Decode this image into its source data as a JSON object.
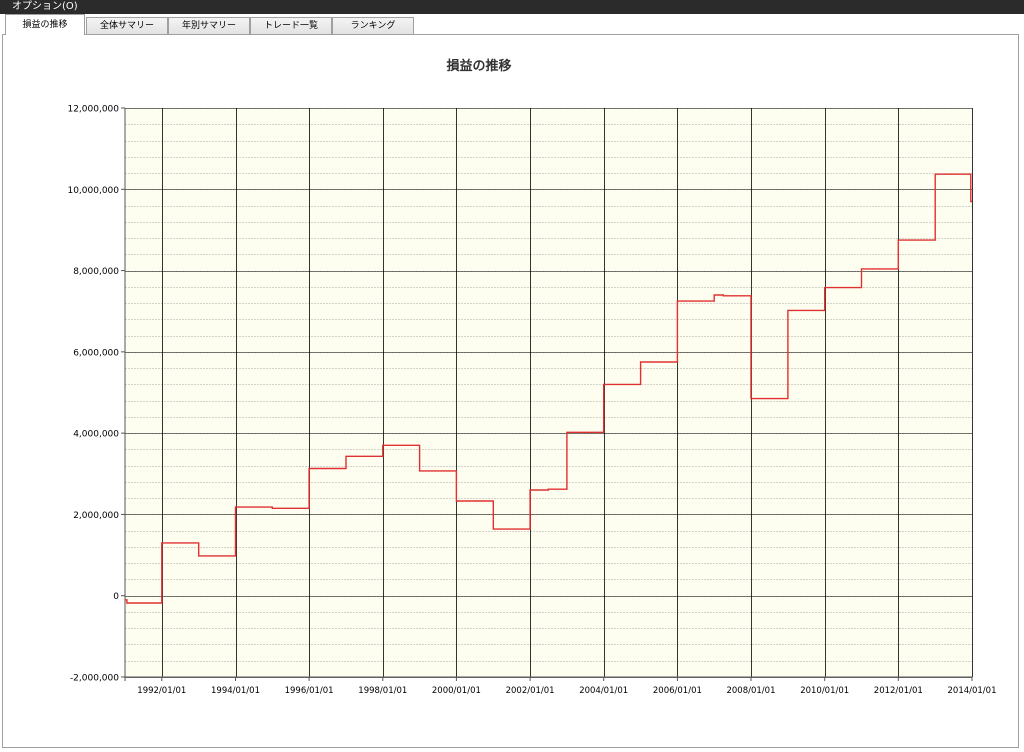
{
  "menubar": {
    "options_label": "オプション(O)"
  },
  "tabs": [
    {
      "label": "損益の推移",
      "active": true
    },
    {
      "label": "全体サマリー",
      "active": false
    },
    {
      "label": "年別サマリー",
      "active": false
    },
    {
      "label": "トレード一覧",
      "active": false
    },
    {
      "label": "ランキング",
      "active": false
    }
  ],
  "colors": {
    "plot_background": "#fefef0",
    "line": "#e03030",
    "major_grid": "#000000",
    "minor_grid": "#a8a8a8"
  },
  "chart_data": {
    "type": "line",
    "title": "損益の推移",
    "xlabel": "",
    "ylabel": "",
    "x_range": [
      "1991/01/01",
      "2014/01/01"
    ],
    "ylim": [
      -2000000,
      12000000
    ],
    "y_ticks": [
      -2000000,
      0,
      2000000,
      4000000,
      6000000,
      8000000,
      10000000,
      12000000
    ],
    "y_tick_labels": [
      "-2,000,000",
      "0",
      "2,000,000",
      "4,000,000",
      "6,000,000",
      "8,000,000",
      "10,000,000",
      "12,000,000"
    ],
    "x_ticks": [
      "1992/01/01",
      "1994/01/01",
      "1996/01/01",
      "1998/01/01",
      "2000/01/01",
      "2002/01/01",
      "2004/01/01",
      "2006/01/01",
      "2008/01/01",
      "2010/01/01",
      "2012/01/01",
      "2014/01/01"
    ],
    "step": true,
    "grid": true,
    "legend": "none",
    "series": [
      {
        "points": [
          [
            "1991/01/01",
            -100000
          ],
          [
            "1991/01/20",
            -180000
          ],
          [
            "1992/01/01",
            1300000
          ],
          [
            "1993/01/01",
            980000
          ],
          [
            "1994/01/01",
            2180000
          ],
          [
            "1995/01/01",
            2150000
          ],
          [
            "1996/01/01",
            3130000
          ],
          [
            "1997/01/01",
            3430000
          ],
          [
            "1998/01/01",
            3700000
          ],
          [
            "1999/01/01",
            3070000
          ],
          [
            "2000/01/01",
            2330000
          ],
          [
            "2001/01/01",
            1640000
          ],
          [
            "2002/01/01",
            2600000
          ],
          [
            "2002/07/01",
            2620000
          ],
          [
            "2003/01/01",
            4020000
          ],
          [
            "2004/01/01",
            5200000
          ],
          [
            "2005/01/01",
            5750000
          ],
          [
            "2006/01/01",
            7250000
          ],
          [
            "2007/01/01",
            7400000
          ],
          [
            "2007/04/01",
            7380000
          ],
          [
            "2008/01/01",
            4850000
          ],
          [
            "2009/01/01",
            7020000
          ],
          [
            "2010/01/01",
            7580000
          ],
          [
            "2011/01/01",
            8040000
          ],
          [
            "2012/01/01",
            8750000
          ],
          [
            "2013/01/01",
            10370000
          ],
          [
            "2013/12/20",
            9700000
          ]
        ]
      }
    ]
  }
}
